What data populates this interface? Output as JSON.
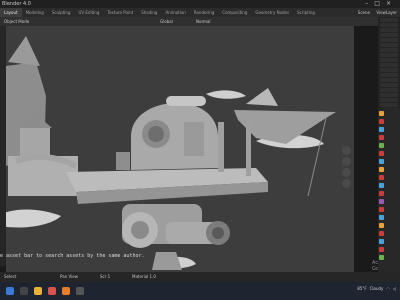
{
  "window": {
    "title": "Blender 4.0"
  },
  "menu": {
    "tabs": [
      "Layout",
      "Modeling",
      "Sculpting",
      "UV Editing",
      "Texture Paint",
      "Shading",
      "Animation",
      "Rendering",
      "Compositing",
      "Geometry Nodes",
      "Scripting"
    ],
    "active_index": 0,
    "scene_label": "Scene",
    "view_layer_label": "ViewLayer"
  },
  "viewport_header": {
    "mode": "Object Mode",
    "orientation": "Global",
    "shading": "Normal"
  },
  "viewport": {
    "hint_text": "e asset bar to search assets by the same author.",
    "watermark_line1": "Activate",
    "watermark_line2": "Go to Se..."
  },
  "statusbar": {
    "select_label": "Select",
    "item1": "Scr 1",
    "item2": "Material 1.0",
    "select_type": "Pan View"
  },
  "taskbar": {
    "temperature": "85°F",
    "weather": "Cloudy"
  },
  "colors": {
    "viewport_bg": "#3d3d3d",
    "model": "#b4b4b4",
    "prop_icons": [
      "#e8a33b",
      "#c83c3c",
      "#4aa3df",
      "#c83c3c",
      "#6ab04c",
      "#c83c3c",
      "#4aa3df",
      "#e8a33b",
      "#c83c3c",
      "#4aa3df",
      "#c83c3c",
      "#9b59b6",
      "#c83c3c",
      "#4aa3df",
      "#e8a33b",
      "#c83c3c",
      "#4aa3df",
      "#c83c3c",
      "#6ab04c"
    ]
  },
  "icons": [
    "blender-logo",
    "minimize-icon",
    "maximize-icon",
    "close-icon",
    "zoom-icon",
    "hand-icon",
    "camera-icon",
    "grid-icon",
    "windows-start-icon",
    "search-icon",
    "explorer-icon",
    "chrome-icon",
    "blender-icon",
    "wifi-icon",
    "volume-icon"
  ]
}
